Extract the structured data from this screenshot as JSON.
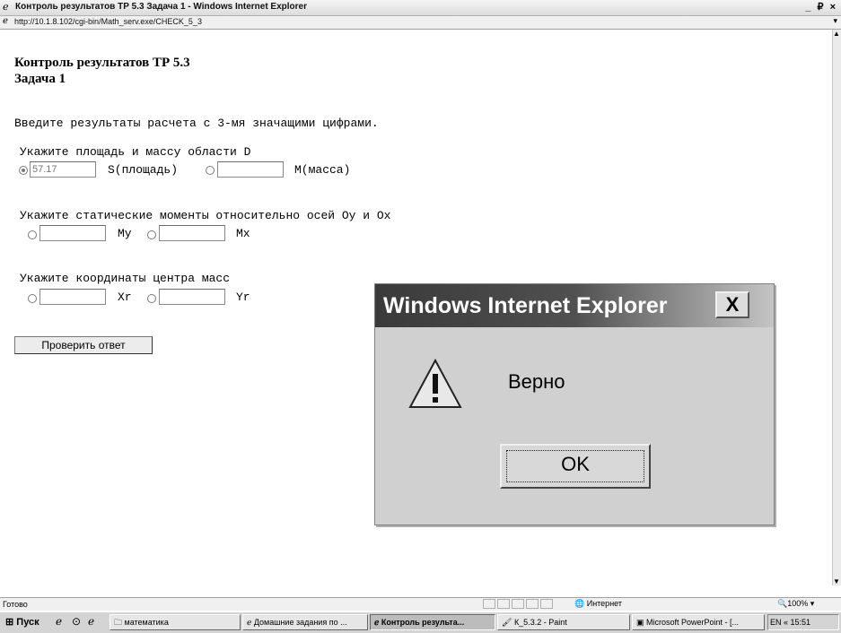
{
  "window": {
    "title": "Контроль результатов ТР 5.3 Задача 1 - Windows Internet Explorer",
    "controls": "_ ₽ ×",
    "address": "http://10.1.8.102/cgi-bin/Math_serv.exe/CHECK_5_3"
  },
  "page": {
    "heading_line1": "Контроль результатов ТР 5.3",
    "heading_line2": "Задача 1",
    "instruction": "Введите результаты расчета с 3-мя значащими цифрами.",
    "section1": {
      "label": "Укажите площадь и массу области D",
      "field1_value": "57.17",
      "field1_label": "S(площадь)",
      "field2_value": "",
      "field2_label": "M(масса)"
    },
    "section2": {
      "label": "Укажите статические моменты относительно осей Oy и Ox",
      "field1_value": "",
      "field1_label": "My",
      "field2_value": "",
      "field2_label": "Mx"
    },
    "section3": {
      "label": "Укажите координаты центра масс",
      "field1_value": "",
      "field1_label": "Xr",
      "field2_value": "",
      "field2_label": "Yr"
    },
    "check_button": "Проверить ответ"
  },
  "dialog": {
    "title": "Windows Internet Explorer",
    "close": "X",
    "message": "Верно",
    "ok": "OK"
  },
  "status": {
    "ready": "Готово",
    "zone": "Интернет",
    "zoom": "100%"
  },
  "taskbar": {
    "start": "Пуск",
    "items": [
      "математика",
      "Домашние задания по ...",
      "Контроль результа...",
      "К_5.3.2 - Paint",
      "Microsoft PowerPoint - [..."
    ],
    "tray": "EN « 15:51"
  }
}
